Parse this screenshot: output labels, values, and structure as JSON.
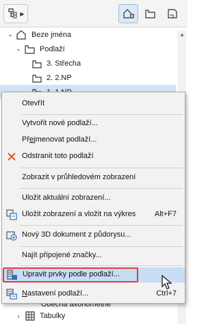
{
  "toolbar": {
    "dropdown_icon": "project-map-icon",
    "view_buttons": [
      "map-view-icon",
      "layout-book-icon",
      "publisher-sets-icon"
    ]
  },
  "tree": {
    "root": "Beze jména",
    "folder": "Podlaží",
    "items": [
      "3. Střecha",
      "2. 2.NP",
      "1. 1.NP"
    ],
    "lower_partial": "Obecná axonometrie",
    "lower_item": "Tabulky"
  },
  "menu": {
    "open": "Otevřít",
    "create": "Vytvořit nové podlaží...",
    "rename_prefix": "Př",
    "rename_u": "e",
    "rename_rest": "jmenovat podlaží...",
    "delete": "Odstranit toto podlaží",
    "show_3d": "Zobrazit v průhledovém zobrazení",
    "save_view": "Uložit aktuální zobrazení...",
    "save_place": "Uložit zobrazení a vložit na výkres",
    "save_place_shortcut": "Alt+F7",
    "new_3d": "Nový 3D dokument z půdorysu...",
    "find_markers": "Najít připojené značky...",
    "edit_elements": "Upravit prvky podle podlaží...",
    "settings_u": "N",
    "settings_rest": "astavení podlaží...",
    "settings_shortcut": "Ctrl+7"
  }
}
